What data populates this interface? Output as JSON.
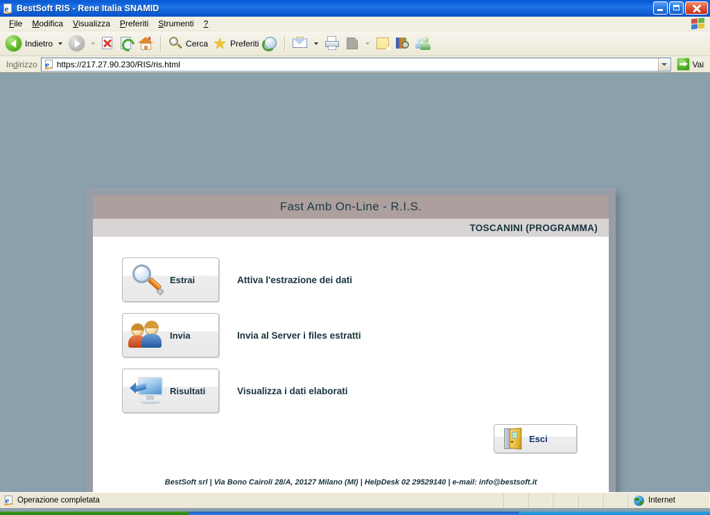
{
  "window": {
    "title": "BestSoft  RIS - Rene Italia SNAMID",
    "icon": "ie-document-icon",
    "buttons": {
      "minimize": "minimize-button",
      "maximize": "maximize-button",
      "close": "close-button"
    }
  },
  "menu": {
    "items": [
      {
        "pre": "",
        "accel": "F",
        "post": "ile"
      },
      {
        "pre": "",
        "accel": "M",
        "post": "odifica"
      },
      {
        "pre": "",
        "accel": "V",
        "post": "isualizza"
      },
      {
        "pre": "",
        "accel": "P",
        "post": "referiti"
      },
      {
        "pre": "",
        "accel": "S",
        "post": "trumenti"
      },
      {
        "pre": "",
        "accel": "?",
        "post": ""
      }
    ]
  },
  "toolbar": {
    "back_label": "Indietro",
    "forward_label": "",
    "stop_label": "",
    "refresh_label": "",
    "home_label": "",
    "search_label": "Cerca",
    "favorites_label": "Preferiti",
    "history_label": "",
    "mail_label": "",
    "print_label": "",
    "edit_label": "",
    "note_label": "",
    "books_label": "",
    "messenger_label": ""
  },
  "address": {
    "label_pre": "In",
    "label_accel": "d",
    "label_post": "irizzo",
    "url": "https://217.27.90.230/RIS/ris.html",
    "placeholder": "",
    "go_label": "Vai"
  },
  "app": {
    "title": "Fast Amb On-Line - R.I.S.",
    "user": "TOSCANINI (PROGRAMMA)",
    "actions": [
      {
        "button_label": "Estrai",
        "icon": "magnifier-icon",
        "description": "Attiva l'estrazione dei dati"
      },
      {
        "button_label": "Invia",
        "icon": "two-people-icon",
        "description": "Invia al Server i files estratti"
      },
      {
        "button_label": "Risultati",
        "icon": "monitor-icon",
        "description": "Visualizza i dati elaborati"
      }
    ],
    "exit_label": "Esci",
    "exit_icon": "exit-door-icon",
    "footer": "BestSoft srl | Via Bono Cairoli 28/A, 20127 Milano (MI) | HelpDesk 02 29529140 | e-mail: info@bestsoft.it"
  },
  "statusbar": {
    "message": "Operazione completata",
    "zone": "Internet"
  },
  "colors": {
    "titlebar_blue": "#1f75e6",
    "page_background": "#8ba0ad",
    "app_header": "#ac9f9d",
    "app_subheader": "#d8d4d4",
    "heading_text": "#16333c",
    "exit_text": "#17386e",
    "chrome_beige": "#ece9d8"
  }
}
